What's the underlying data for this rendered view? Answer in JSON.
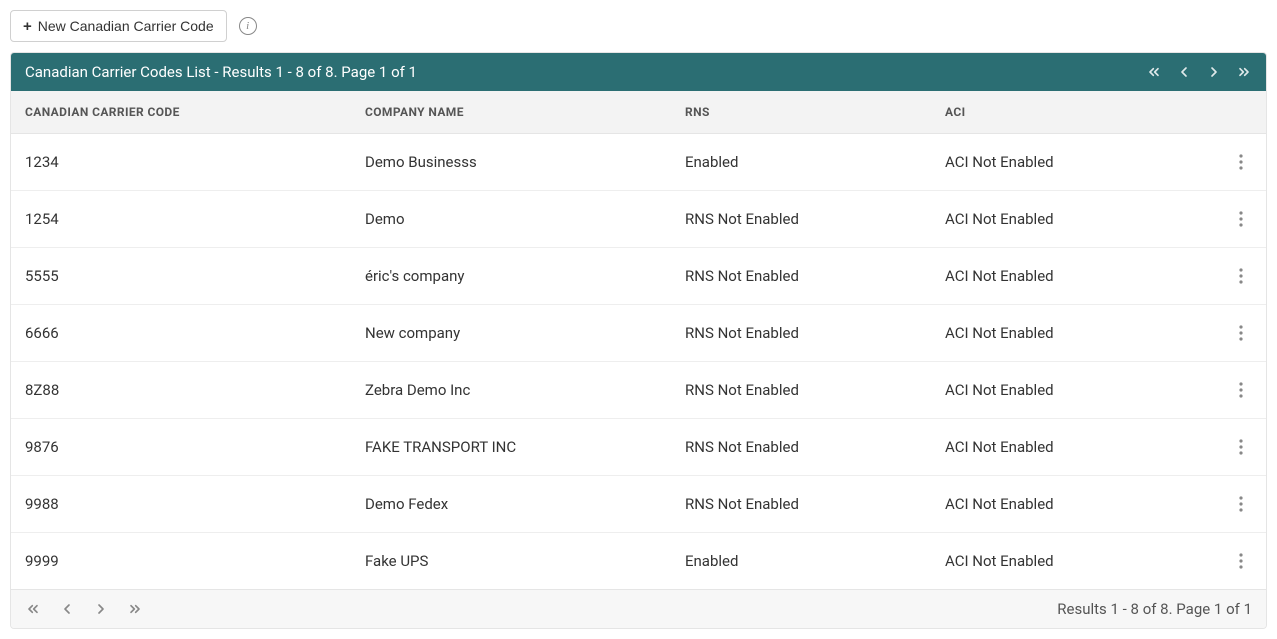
{
  "toolbar": {
    "new_button_label": "New Canadian Carrier Code"
  },
  "panel": {
    "header_title": "Canadian Carrier Codes List - Results 1 - 8 of 8. Page 1 of 1",
    "footer_summary": "Results 1 - 8 of 8. Page 1 of 1"
  },
  "columns": {
    "code": "CANADIAN CARRIER CODE",
    "company": "COMPANY NAME",
    "rns": "RNS",
    "aci": "ACI"
  },
  "rows": [
    {
      "code": "1234",
      "company": "Demo Businesss",
      "rns": "Enabled",
      "aci": "ACI Not Enabled"
    },
    {
      "code": "1254",
      "company": "Demo",
      "rns": "RNS Not Enabled",
      "aci": "ACI Not Enabled"
    },
    {
      "code": "5555",
      "company": "éric's company",
      "rns": "RNS Not Enabled",
      "aci": "ACI Not Enabled"
    },
    {
      "code": "6666",
      "company": "New company",
      "rns": "RNS Not Enabled",
      "aci": "ACI Not Enabled"
    },
    {
      "code": "8Z88",
      "company": "Zebra Demo Inc",
      "rns": "RNS Not Enabled",
      "aci": "ACI Not Enabled"
    },
    {
      "code": "9876",
      "company": "FAKE TRANSPORT INC",
      "rns": "RNS Not Enabled",
      "aci": "ACI Not Enabled"
    },
    {
      "code": "9988",
      "company": "Demo Fedex",
      "rns": "RNS Not Enabled",
      "aci": "ACI Not Enabled"
    },
    {
      "code": "9999",
      "company": "Fake UPS",
      "rns": "Enabled",
      "aci": "ACI Not Enabled"
    }
  ]
}
